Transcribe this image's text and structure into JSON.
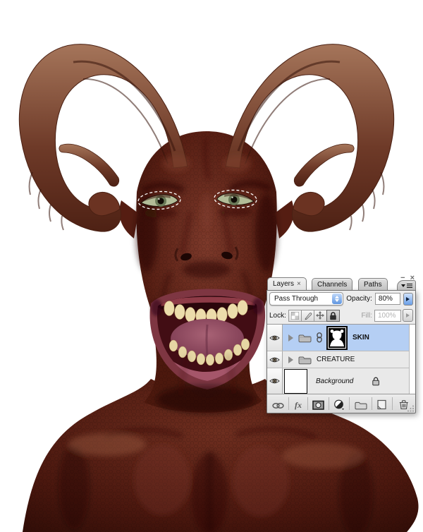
{
  "canvas": {
    "alt": "horned-demon-creature-photo",
    "colors": {
      "skin": "#5e241a",
      "horns": "#8a5a40",
      "eyes": "#b2bc98",
      "background": "#ffffff"
    }
  },
  "panel": {
    "window": {
      "minimize": "−",
      "close": "×"
    },
    "tabs": [
      {
        "label": "Layers",
        "close": "×",
        "active": true
      },
      {
        "label": "Channels"
      },
      {
        "label": "Paths"
      }
    ],
    "blend_mode": {
      "value": "Pass Through"
    },
    "opacity": {
      "label": "Opacity:",
      "value": "80%"
    },
    "lock": {
      "label": "Lock:"
    },
    "fill": {
      "label": "Fill:",
      "value": "100%"
    },
    "layers": [
      {
        "name": "SKIN",
        "type": "group",
        "selected": true,
        "visible": true,
        "has_mask": true,
        "mask_linked": true
      },
      {
        "name": "CREATURE",
        "type": "group",
        "visible": true
      },
      {
        "name": "Background",
        "type": "background",
        "visible": true,
        "locked": true
      }
    ],
    "footer": {
      "fx_label": "fx"
    },
    "colors": {
      "selected_row": "#b5cff4",
      "stepper_blue": "#6a9fe8"
    }
  }
}
